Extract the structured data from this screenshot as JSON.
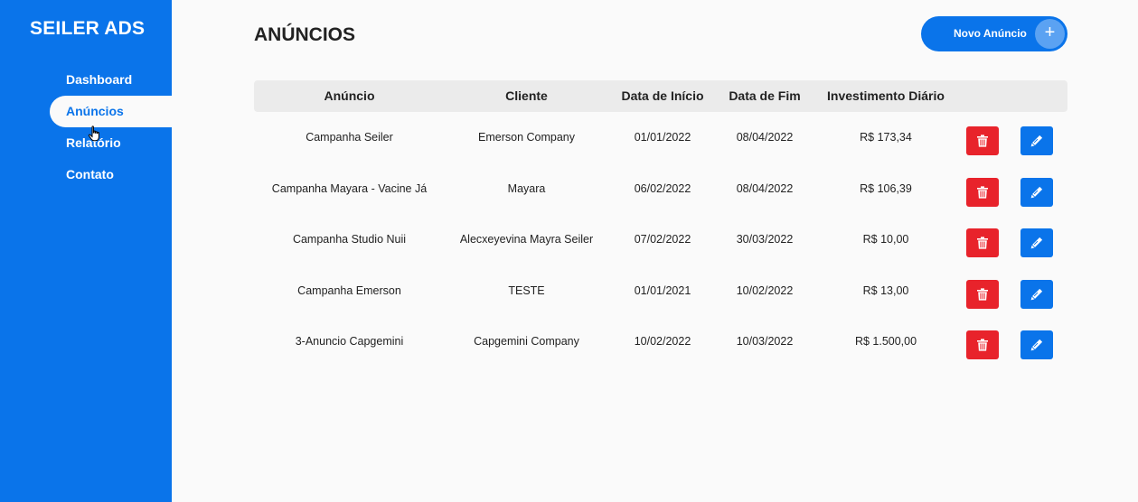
{
  "sidebar": {
    "brand": "SEILER ADS",
    "items": [
      {
        "label": "Dashboard",
        "active": false
      },
      {
        "label": "Anúncios",
        "active": true
      },
      {
        "label": "Relatório",
        "active": false
      },
      {
        "label": "Contato",
        "active": false
      }
    ]
  },
  "header": {
    "title": "ANÚNCIOS",
    "new_button_label": "Novo Anúncio",
    "new_button_icon": "plus-icon"
  },
  "table": {
    "columns": [
      "Anúncio",
      "Cliente",
      "Data de Início",
      "Data de Fim",
      "Investimento Diário"
    ],
    "rows": [
      [
        "Campanha Seiler",
        "Emerson Company",
        "01/01/2022",
        "08/04/2022",
        "R$ 173,34"
      ],
      [
        "Campanha Mayara - Vacine Já",
        "Mayara",
        "06/02/2022",
        "08/04/2022",
        "R$ 106,39"
      ],
      [
        "Campanha Studio Nuii",
        "Alecxeyevina Mayra Seiler",
        "07/02/2022",
        "30/03/2022",
        "R$ 10,00"
      ],
      [
        "Campanha Emerson",
        "TESTE",
        "01/01/2021",
        "10/02/2022",
        "R$ 13,00"
      ],
      [
        "3-Anuncio Capgemini",
        "Capgemini Company",
        "10/02/2022",
        "10/03/2022",
        "R$ 1.500,00"
      ]
    ],
    "row_actions": [
      "trash-icon",
      "pencil-icon"
    ]
  },
  "colors": {
    "primary": "#0a74ea",
    "danger": "#e8232b",
    "background": "#fafafa",
    "header_row": "#ebebeb"
  }
}
